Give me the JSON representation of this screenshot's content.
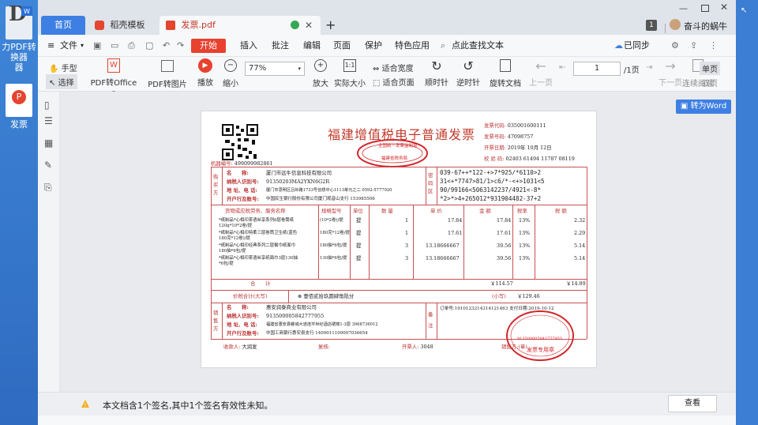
{
  "desktop": {
    "icons": [
      {
        "label": "力PDF转换器"
      },
      {
        "label": "发票"
      }
    ]
  },
  "tabs": {
    "home": "首页",
    "template": "稻壳模板",
    "document": "发票.pdf",
    "add": "+"
  },
  "window": {
    "badge": "1",
    "user": "奋斗的蜗牛"
  },
  "menu": {
    "file": "文件",
    "items": [
      "开始",
      "插入",
      "批注",
      "编辑",
      "页面",
      "保护",
      "特色应用"
    ],
    "search": "点此查找文本",
    "sync": "已同步",
    "share": "分享"
  },
  "toolbar": {
    "hand": "手型",
    "select": "选择",
    "pdf_office": "PDF转Office",
    "pdf_image": "PDF转图片",
    "play": "播放",
    "zoom_out": "缩小",
    "zoom_value": "77%",
    "zoom_in": "放大",
    "actual": "实际大小",
    "fit_width": "适合宽度",
    "fit_page": "适合页面",
    "rotate_cw": "顺时针",
    "rotate_ccw": "逆时针",
    "rotate_doc": "旋转文档",
    "prev": "上一页",
    "page_value": "1",
    "page_total": "/1页",
    "next": "下一页",
    "continuous": "连续阅读",
    "single": "单页",
    "double": "双页"
  },
  "to_word": "转为Word",
  "invoice": {
    "title": "福建增值税电子普通发票",
    "code_label": "发票代码:",
    "code": "035001600111",
    "number_label": "发票号码:",
    "number": "47098757",
    "date_label": "开票日期:",
    "date": "2019年 10月 12日",
    "check_label": "校 验 码:",
    "check": "02403 61494 11787 08119",
    "machine_label": "机器编号:",
    "machine": "499099982861",
    "buyer_side": "购买方",
    "buyer_name_label": "名　　称:",
    "buyer_name": "厦门市远牛信息科技有限公司",
    "buyer_tax_label": "纳税人识别号:",
    "buyer_tax": "91350203MA2YXN6G2R",
    "buyer_addr_label": "地 址、电 话:",
    "buyer_addr": "厦门市思明区吕岭路1733号创想中心1113单元之二 0592-5777920",
    "buyer_bank_label": "开户行及账号:",
    "buyer_bank": "中国民生银行股份有限公司厦门观音山支行 153985506",
    "pwd_label": "密码区",
    "pwd_lines": [
      "039-67++*122-+>7*925/*6110>2",
      "31<+*7747>81/1>c6/*-<+>1031<5",
      "90/99166<5063142237/4921<-8*",
      "*2>*>4+265012*931904482-37+2"
    ],
    "head_item": "货物或应税劳务、服务名称",
    "head_spec": "规格型号",
    "head_unit": "单位",
    "head_qty": "数 量",
    "head_price": "单 价",
    "head_amount": "金 额",
    "head_rate": "税率",
    "head_tax": "税 额",
    "rows": [
      {
        "name": "*纸制品*心相印茶语丝享系列6层卷筒纸",
        "name2": "120g*10*2卷/提",
        "spec": "(10*2卷)/提",
        "unit": "提",
        "qty": "1",
        "price": "17.84",
        "amount": "17.84",
        "rate": "13%",
        "tax": "2.32"
      },
      {
        "name": "*纸制品*心相印特柔三层卷筒卫生纸(蓝色",
        "name2": "180克*12卷)/提",
        "spec": "180克*12卷/提",
        "unit": "提",
        "qty": "1",
        "price": "17.61",
        "amount": "17.61",
        "rate": "13%",
        "tax": "2.29"
      },
      {
        "name": "*纸制品*心相印经典系列二层餐巾纸面巾",
        "name2": "180抽*6包/提",
        "spec": "180抽*6包/提",
        "unit": "提",
        "qty": "3",
        "price": "13.18666667",
        "amount": "39.56",
        "rate": "13%",
        "tax": "5.14"
      },
      {
        "name": "*纸制品*心相印茶语丝享纸面巾3层130抽",
        "name2": "*6包/提",
        "spec": "130抽*6包/提",
        "unit": "提",
        "qty": "3",
        "price": "13.18666667",
        "amount": "39.56",
        "rate": "13%",
        "tax": "5.14"
      }
    ],
    "total_label": "合　　计",
    "total_amount": "￥114.57",
    "total_tax": "￥14.89",
    "grand_label": "价税合计(大写)",
    "grand_words": "壹佰贰拾玖圆肆角陆分",
    "grand_small_label": "(小写)",
    "grand_small": "￥129.46",
    "seller_side": "销售方",
    "seller_name_label": "名　　称:",
    "seller_name": "惠安润泰商业有限公司",
    "seller_tax_label": "纳税人识别号:",
    "seller_tax": "913500005842777955",
    "seller_addr_label": "地 址、电 话:",
    "seller_addr": "福建省惠安县螺城大道连岑世纪酒店裙楼1-3层 3968736012",
    "seller_bank_label": "开户行及账号:",
    "seller_bank": "中国工商银行惠安县支行 1409011109007036654",
    "note_label": "备注",
    "note": "订单号:1910123214314121463 支付日期:2019-10-12",
    "payee_label": "收款人:",
    "payee": "大润发",
    "review_label": "复核:",
    "drawer_label": "开票人:",
    "drawer": "3048",
    "seller_stamp_label": "销售方:(章)",
    "stamp_top_text": "全国统一发票监制章",
    "stamp_top_sub": "福建省税务局",
    "stamp_bottom_text": "发票专用章",
    "stamp_bottom_num": "913500005842777955"
  },
  "signature": {
    "message": "本文档含1个签名,其中1个签名有效性未知。",
    "view": "查看"
  },
  "colors": {
    "accent": "#3d7fe3",
    "invoice_red": "#c23b2b",
    "stamp_red": "#d2262a"
  }
}
